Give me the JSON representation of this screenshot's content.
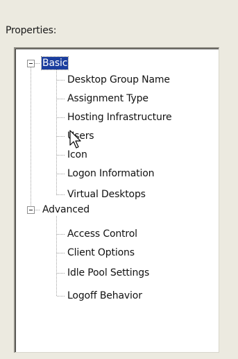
{
  "panel": {
    "heading": "Properties:"
  },
  "tree": {
    "groups": [
      {
        "label": "Basic",
        "expanded": true,
        "selected": true,
        "items": [
          "Desktop Group Name",
          "Assignment Type",
          "Hosting Infrastructure",
          "Users",
          "Icon",
          "Logon Information",
          "Virtual Desktops"
        ]
      },
      {
        "label": "Advanced",
        "expanded": true,
        "selected": false,
        "items": [
          "Access Control",
          "Client Options",
          "Idle Pool Settings",
          "Logoff Behavior"
        ]
      }
    ]
  },
  "colors": {
    "selection": "#1b3e9e",
    "background": "#eceae0"
  }
}
